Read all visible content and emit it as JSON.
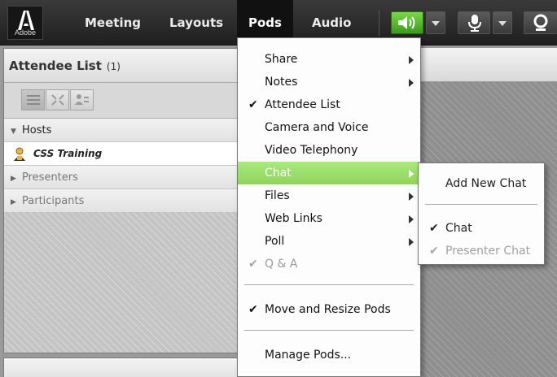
{
  "logo": {
    "text": "Adobe"
  },
  "menubar": {
    "items": [
      {
        "label": "Meeting"
      },
      {
        "label": "Layouts"
      },
      {
        "label": "Pods",
        "active": true
      },
      {
        "label": "Audio"
      }
    ],
    "buttons": [
      {
        "icon": "speaker-icon",
        "state": "on",
        "color": "#4caf2a"
      },
      {
        "icon": "chevron-down-icon"
      },
      {
        "icon": "microphone-icon"
      },
      {
        "icon": "chevron-down-icon"
      },
      {
        "icon": "camera-icon"
      }
    ]
  },
  "attendee_pod": {
    "title": "Attendee List",
    "count": "(1)",
    "view_buttons": [
      {
        "icon": "list-view-icon",
        "selected": true
      },
      {
        "icon": "expand-view-icon"
      },
      {
        "icon": "attendee-view-icon"
      }
    ],
    "groups": [
      {
        "label": "Hosts",
        "expanded": true,
        "users": [
          {
            "name": "CSS Training",
            "icon": "host-icon"
          }
        ]
      },
      {
        "label": "Presenters",
        "expanded": false,
        "users": []
      },
      {
        "label": "Participants",
        "expanded": false,
        "users": []
      }
    ]
  },
  "pods_menu": {
    "items": [
      {
        "label": "Share",
        "submenu": true
      },
      {
        "label": "Notes",
        "submenu": true
      },
      {
        "label": "Attendee List",
        "checked": true
      },
      {
        "label": "Camera and Voice"
      },
      {
        "label": "Video Telephony"
      },
      {
        "label": "Chat",
        "submenu": true,
        "highlighted": true
      },
      {
        "label": "Files",
        "submenu": true
      },
      {
        "label": "Web Links",
        "submenu": true
      },
      {
        "label": "Poll",
        "submenu": true
      },
      {
        "label": "Q & A",
        "checked": true,
        "disabled": true
      },
      {
        "label": "Move and Resize Pods",
        "checked": true
      },
      {
        "label": "Manage Pods..."
      }
    ],
    "highlight_color": "#9ddd6e"
  },
  "chat_submenu": {
    "items": [
      {
        "label": "Add New Chat"
      },
      {
        "label": "Chat",
        "checked": true
      },
      {
        "label": "Presenter Chat",
        "checked": true,
        "disabled": true
      }
    ]
  }
}
